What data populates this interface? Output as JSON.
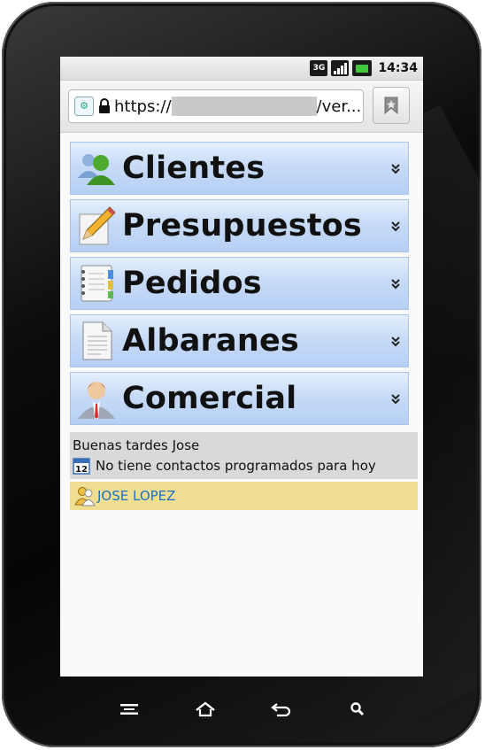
{
  "status": {
    "time": "14:34",
    "network": "3G"
  },
  "browser": {
    "url_prefix": "https://",
    "url_suffix": "/ver..."
  },
  "menu": {
    "items": [
      {
        "label": "Clientes",
        "icon": "users-icon"
      },
      {
        "label": "Presupuestos",
        "icon": "pencil-paper-icon"
      },
      {
        "label": "Pedidos",
        "icon": "notebook-icon"
      },
      {
        "label": "Albaranes",
        "icon": "document-icon"
      },
      {
        "label": "Comercial",
        "icon": "salesman-icon"
      }
    ]
  },
  "greeting": {
    "hello": "Buenas tardes Jose",
    "calendar_day": "12",
    "message": "No tiene contactos programados para hoy"
  },
  "user": {
    "name": "JOSE LOPEZ"
  },
  "colors": {
    "menu_bg": "#c7dbf7",
    "user_bar": "#f0df93",
    "link": "#1b6fc2"
  }
}
